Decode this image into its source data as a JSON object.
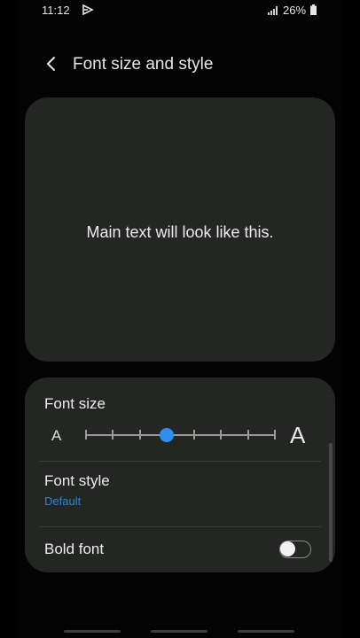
{
  "status_bar": {
    "time": "11:12",
    "battery": "26%",
    "icons": [
      "cast-icon",
      "signal-icon",
      "battery-icon"
    ]
  },
  "header": {
    "title": "Font size and style",
    "back_icon": "chevron-left-icon"
  },
  "preview": {
    "text": "Main text will look like this."
  },
  "font_size": {
    "label": "Font size",
    "small_glyph": "A",
    "large_glyph": "A",
    "steps": 8,
    "current_step": 3
  },
  "font_style": {
    "label": "Font style",
    "value": "Default"
  },
  "bold_font": {
    "label": "Bold font",
    "enabled": false
  },
  "colors": {
    "accent": "#2f8ff0",
    "card_background": "#242624",
    "screen_background": "#020302",
    "link_text": "#2b83d9"
  }
}
